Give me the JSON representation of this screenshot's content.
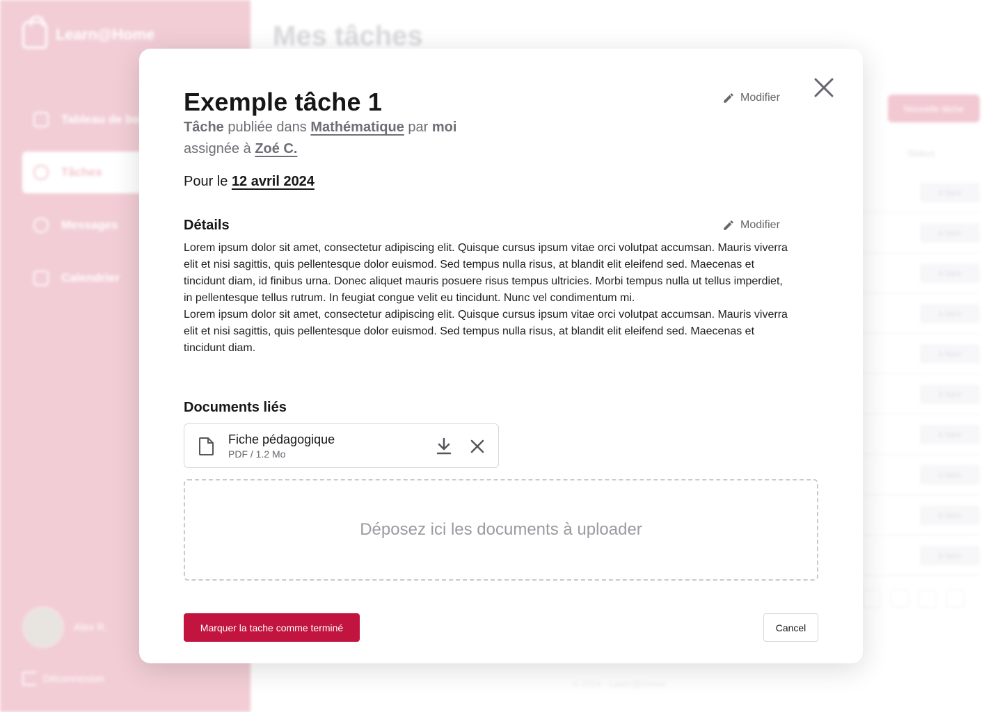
{
  "background": {
    "app_name": "Learn@Home",
    "page_title": "Mes tâches",
    "nav": [
      {
        "label": "Tableau de bord",
        "icon": "grid-icon"
      },
      {
        "label": "Tâches",
        "icon": "check-circle-icon"
      },
      {
        "label": "Messages",
        "icon": "chat-icon"
      },
      {
        "label": "Calendrier",
        "icon": "calendar-icon"
      }
    ],
    "user_name": "Alex R.",
    "logout_label": "Déconnexion",
    "new_task_label": "Nouvelle tâche",
    "status_header": "Status",
    "row_status": "à faire",
    "footer": "© 2024 - Learn@Home"
  },
  "modal": {
    "title": "Exemple tâche 1",
    "edit_label": "Modifier",
    "meta": {
      "type": "Tâche",
      "published_in_text": "publiée dans",
      "subject": "Mathématique",
      "by_text": "par",
      "author": "moi",
      "assigned_text": "assignée à",
      "assignee": "Zoé C."
    },
    "due": {
      "prefix": "Pour le",
      "date": "12 avril 2024"
    },
    "details": {
      "title": "Détails",
      "paragraph1": "Lorem ipsum dolor sit amet, consectetur adipiscing elit. Quisque cursus ipsum vitae orci volutpat accumsan. Mauris viverra elit et nisi sagittis, quis pellentesque dolor euismod. Sed tempus nulla risus, at blandit elit eleifend sed. Maecenas et tincidunt diam, id finibus urna. Donec aliquet mauris posuere risus tempus ultricies. Morbi tempus nulla ut tellus imperdiet, in pellentesque tellus rutrum. In feugiat congue velit eu tincidunt. Nunc vel condimentum mi.",
      "paragraph2": "Lorem ipsum dolor sit amet, consectetur adipiscing elit. Quisque cursus ipsum vitae orci volutpat accumsan. Mauris viverra elit et nisi sagittis, quis pellentesque dolor euismod. Sed tempus nulla risus, at blandit elit eleifend sed. Maecenas et tincidunt diam."
    },
    "documents": {
      "title": "Documents liés",
      "items": [
        {
          "name": "Fiche pédagogique",
          "meta": "PDF / 1.2 Mo"
        }
      ],
      "dropzone_text": "Déposez ici les documents à uploader"
    },
    "primary_button": "Marquer la tache comme terminé",
    "cancel_button": "Cancel",
    "colors": {
      "primary": "#c1143f",
      "sidebar": "#f2cdd5"
    }
  }
}
